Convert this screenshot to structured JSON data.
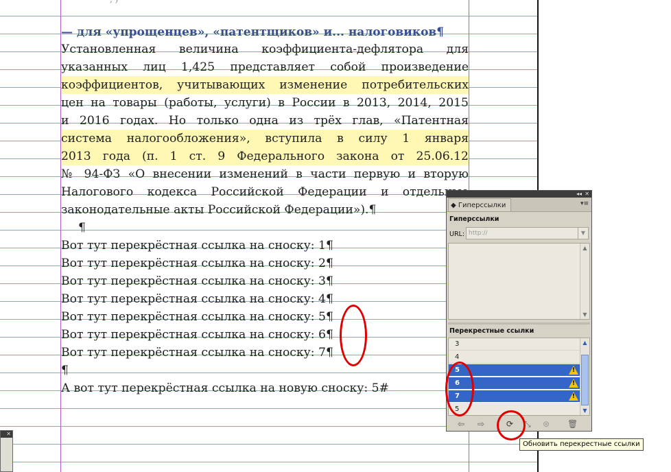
{
  "document": {
    "top_fragment": ", )",
    "heading": "— для «упрощенцев», «патентщиков» и... налоговиков¶",
    "paragraph_lines": [
      "Установленная величина коэффициента-дефлятора для",
      "указанных лиц 1,425 представляет собой произведение",
      "коэффициентов, учитывающих изменение потребительских",
      "цен на товары (работы, услуги) в России в 2013, 2014, 2015",
      "и 2016 годах. Но только одна из трёх глав, «Патентная",
      "система налогообложения», вступила в силу 1 января",
      "2013 года (п. 1 ст. 9 Федерального закона от 25.06.12",
      "№ 94-ФЗ «О внесении изменений в части первую и вторую",
      "Налогового кодекса Российской Федерации и отдельные",
      "законодательные акты Российской Федерации»).¶"
    ],
    "empty_para": "¶",
    "xref_lines": [
      "Вот тут перекрёстная ссылка на сноску: 1¶",
      "Вот тут перекрёстная ссылка на сноску: 2¶",
      "Вот тут перекрёстная ссылка на сноску: 3¶",
      "Вот тут перекрёстная ссылка на сноску: 4¶",
      "Вот тут перекрёстная ссылка на сноску: 5¶",
      "Вот тут перекрёстная ссылка на сноску: 6¶",
      "Вот тут перекрёстная ссылка на сноску: 7¶"
    ],
    "empty_para2": "¶",
    "new_xref": "А вот тут перекрёстная ссылка на новую сноску: 5#"
  },
  "panel": {
    "topbar_collapse": "◂◂",
    "topbar_close": "✕",
    "tab_label": "◆ Гиперссылки",
    "menu_icon": "▾≡",
    "hyperlinks_title": "Гиперссылки",
    "url_label": "URL:",
    "url_placeholder": "http://",
    "xrefs_title": "Перекрестные ссылки",
    "xref_items": [
      {
        "label": "3",
        "selected": false,
        "warning": false
      },
      {
        "label": "4",
        "selected": false,
        "warning": false
      },
      {
        "label": "5",
        "selected": true,
        "warning": true
      },
      {
        "label": "6",
        "selected": true,
        "warning": true
      },
      {
        "label": "7",
        "selected": true,
        "warning": true
      },
      {
        "label": "5",
        "selected": false,
        "warning": false
      }
    ],
    "tooltip": "Обновить перекрестные ссылки"
  },
  "colors": {
    "baseline_grid": "#7fa7ee",
    "margin_guide": "#b05ec8",
    "highlight": "#fff8b4",
    "selection": "#3466c8",
    "annotation_red": "#e00000"
  }
}
